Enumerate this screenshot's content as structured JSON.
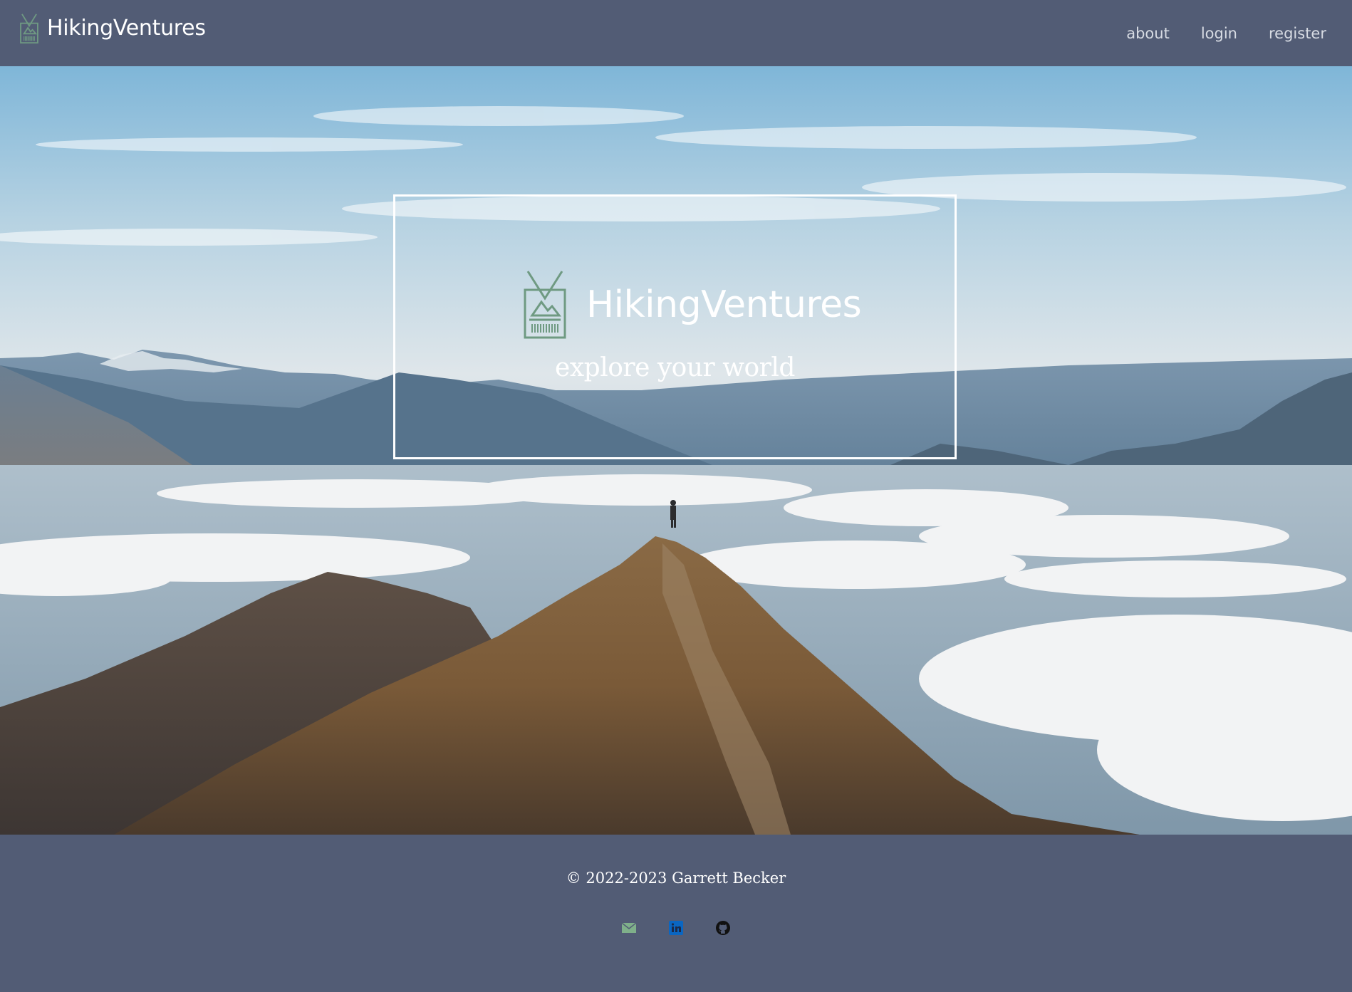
{
  "brand": {
    "name": "HikingVentures",
    "logo_icon": "id-badge-mountain-icon"
  },
  "nav": {
    "links": [
      {
        "label": "about"
      },
      {
        "label": "login"
      },
      {
        "label": "register"
      }
    ]
  },
  "hero": {
    "title": "HikingVentures",
    "tagline": "explore your world",
    "logo_icon": "id-badge-mountain-icon",
    "background": "mountain-ridge-above-clouds-photo"
  },
  "footer": {
    "copyright": "© 2022-2023 Garrett Becker",
    "social": [
      {
        "icon": "email-icon",
        "color": "#7fb08a"
      },
      {
        "icon": "linkedin-icon",
        "color": "#0a66c2"
      },
      {
        "icon": "github-icon",
        "color": "#111111"
      }
    ]
  },
  "colors": {
    "nav_background": "#525c75",
    "footer_background": "#525c75",
    "logo_green": "#6f9a82",
    "text_white": "#ffffff",
    "nav_link": "#d7dbe3"
  }
}
